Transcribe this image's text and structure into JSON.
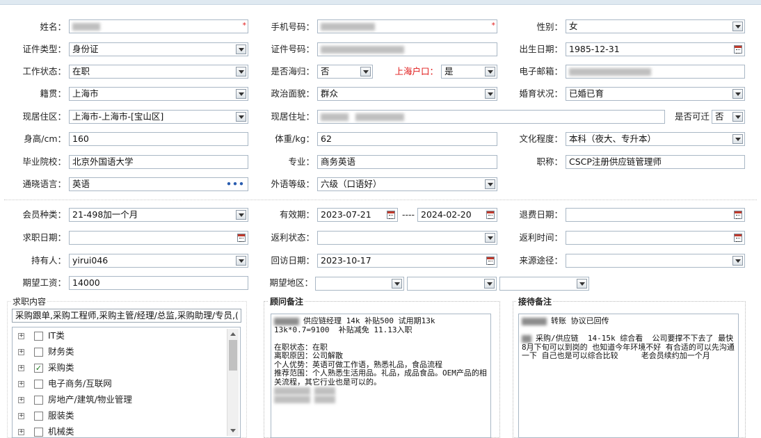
{
  "personal": {
    "name_label": "姓名：",
    "mobile_label": "手机号码：",
    "gender_label": "性别：",
    "gender_value": "女",
    "idtype_label": "证件类型：",
    "idtype_value": "身份证",
    "idno_label": "证件号码：",
    "birth_label": "出生日期：",
    "birth_value": "1985-12-31",
    "workstatus_label": "工作状态：",
    "workstatus_value": "在职",
    "returnee_label": "是否海归：",
    "returnee_value": "否",
    "shanghai_hukou_label": "上海户口：",
    "shanghai_hukou_value": "是",
    "email_label": "电子邮箱：",
    "native_label": "籍贯：",
    "native_value": "上海市",
    "political_label": "政治面貌：",
    "political_value": "群众",
    "marital_label": "婚育状况：",
    "marital_value": "已婚已育",
    "residence_area_label": "现居住区：",
    "residence_area_value": "上海市-上海市-[宝山区]",
    "residence_addr_label": "现居住址：",
    "relocate_label": "是否可迁",
    "relocate_value": "否",
    "height_label": "身高/cm：",
    "height_value": "160",
    "weight_label": "体重/kg：",
    "weight_value": "62",
    "education_label": "文化程度：",
    "education_value": "本科（夜大、专升本）",
    "school_label": "毕业院校：",
    "school_value": "北京外国语大学",
    "major_label": "专业：",
    "major_value": "商务英语",
    "title_label": "职称：",
    "title_value": "CSCP注册供应链管理师",
    "language_label": "通晓语言：",
    "language_value": "英语",
    "language_more": "•••",
    "flevel_label": "外语等级：",
    "flevel_value": "六级（口语好）",
    "required_mark": "*"
  },
  "membership": {
    "type_label": "会员种类：",
    "type_value": "21-498加一个月",
    "valid_label": "有效期：",
    "valid_from": "2023-07-21",
    "valid_sep": "----",
    "valid_to": "2024-02-20",
    "refund_label": "退费日期：",
    "job_date_label": "求职日期：",
    "rebate_status_label": "返利状态：",
    "rebate_time_label": "返利时间：",
    "holder_label": "持有人：",
    "holder_value": "yirui046",
    "revisit_label": "回访日期：",
    "revisit_value": "2023-10-17",
    "source_label": "来源途径：",
    "salary_label": "期望工资：",
    "salary_value": "14000",
    "region_label": "期望地区："
  },
  "job": {
    "legend": "求职内容",
    "summary": "采购跟单,采购工程师,采购主管/经理/总监,采购助理/专员,(",
    "categories": [
      {
        "label": "IT类",
        "checked": false
      },
      {
        "label": "财务类",
        "checked": false
      },
      {
        "label": "采购类",
        "checked": true
      },
      {
        "label": "电子商务/互联网",
        "checked": false
      },
      {
        "label": "房地产/建筑/物业管理",
        "checked": false
      },
      {
        "label": "服装类",
        "checked": false
      },
      {
        "label": "机械类",
        "checked": false
      }
    ],
    "check_glyph": "✓",
    "plus_glyph": "+"
  },
  "consultant": {
    "legend": "顾问备注",
    "line1": "供应链经理 14k 补贴500 试用期13k",
    "line2": "13k*0.7=9100  补贴减免 11.13入职",
    "line3": "在职状态：在职",
    "line4": "离职原因：公司解散",
    "line5": "个人优势：英语可做工作语，熟悉礼品，食品流程",
    "line6": "推荐范围：个人熟悉生活用品。礼品，成品食品。OEM产品的相关流程，其它行业也是可以的。"
  },
  "reception": {
    "legend": "接待备注",
    "line1": "转账 协议已回传",
    "line2": "采购/供应链  14-15k 综合看  公司要撑不下去了 最快8月下旬可以到岗的 也知道今年环境不好 有合适的可以先沟通一下 自己也是可以综合比较     老会员续约加一个月"
  },
  "colors": {
    "accent_red": "#e01919",
    "border": "#a9b7c5"
  }
}
